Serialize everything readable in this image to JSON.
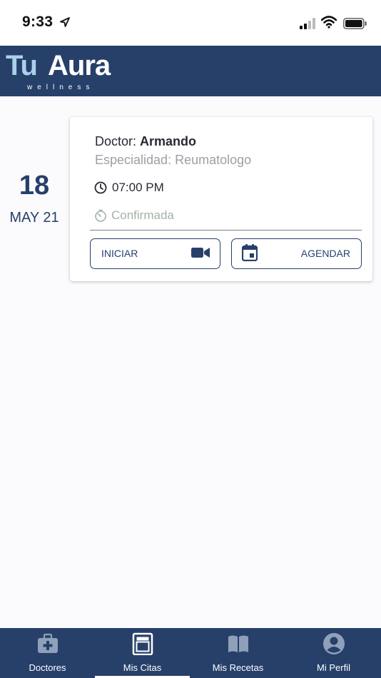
{
  "status_bar": {
    "time": "9:33"
  },
  "brand": {
    "tu": "Tu",
    "aura": "Aura",
    "sub": "wellness"
  },
  "appointment": {
    "day": "18",
    "month": "MAY 21",
    "doctor_prefix": "Doctor: ",
    "doctor_name": "Armando",
    "specialty": "Especialidad: Reumatologo",
    "time": "07:00 PM",
    "status": "Confirmada",
    "start_label": "INICIAR",
    "schedule_label": "AGENDAR"
  },
  "tabs": [
    {
      "label": "Doctores",
      "icon": "medical-kit-icon"
    },
    {
      "label": "Mis Citas",
      "icon": "document-icon",
      "active": true
    },
    {
      "label": "Mis Recetas",
      "icon": "book-icon"
    },
    {
      "label": "Mi Perfil",
      "icon": "account-circle-icon"
    }
  ],
  "colors": {
    "header": "#27406a",
    "brand_accent": "#a9d1ea",
    "status_confirmed": "#a4b2a7",
    "muted_text": "#9aa0a6"
  }
}
